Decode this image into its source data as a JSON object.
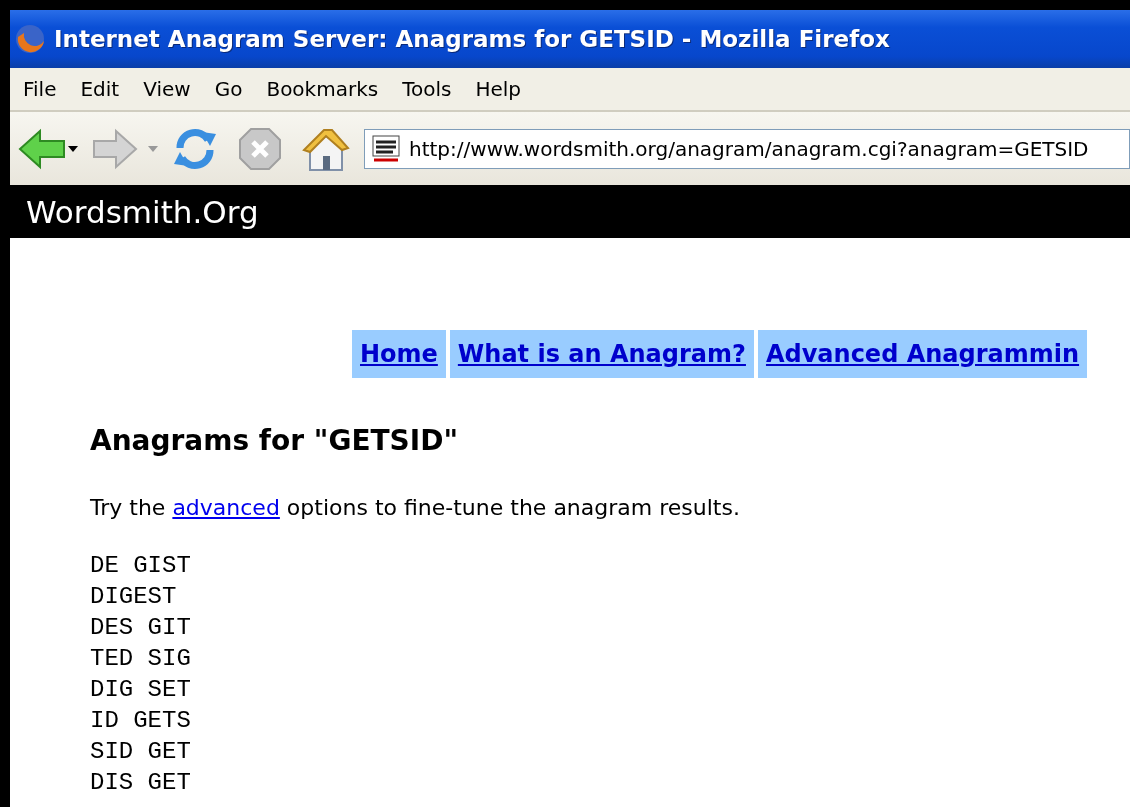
{
  "window": {
    "title": "Internet Anagram Server: Anagrams for GETSID - Mozilla Firefox"
  },
  "menu": [
    "File",
    "Edit",
    "View",
    "Go",
    "Bookmarks",
    "Tools",
    "Help"
  ],
  "address": {
    "value": "http://www.wordsmith.org/anagram/anagram.cgi?anagram=GETSID"
  },
  "site_header": "Wordsmith.Org",
  "nav": [
    "Home",
    "What is an Anagram?",
    "Advanced Anagrammin"
  ],
  "heading": "Anagrams for \"GETSID\"",
  "intro": {
    "before": "Try the ",
    "link": "advanced",
    "after": " options to fine-tune the anagram results."
  },
  "results": [
    "DE GIST",
    "DIGEST",
    "DES GIT",
    "TED SIG",
    "DIG SET",
    "ID GETS",
    "SID GET",
    "DIS GET"
  ]
}
